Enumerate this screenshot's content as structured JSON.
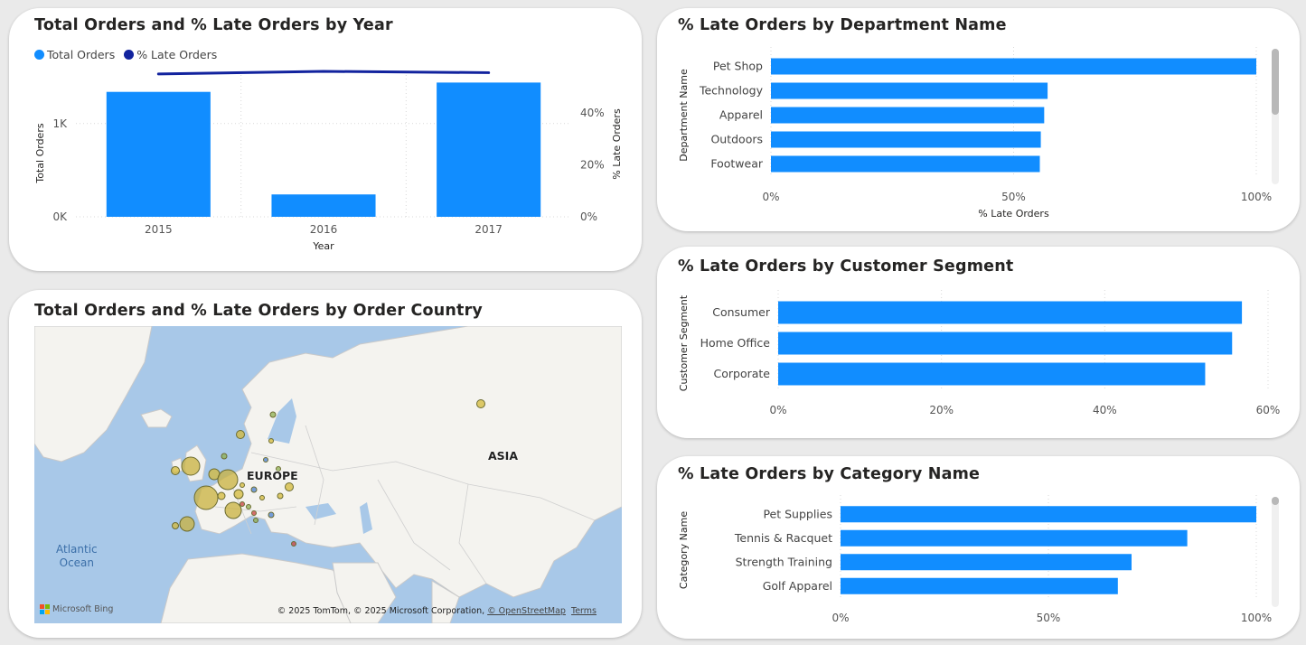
{
  "colors": {
    "bar": "#118dff",
    "line": "#12239e",
    "grid": "#d9d9d9",
    "water": "#a8c8e8",
    "land": "#f4f3ef"
  },
  "card1": {
    "title": "Total Orders and % Late Orders by Year",
    "legend": [
      {
        "label": "Total Orders",
        "color": "#118dff"
      },
      {
        "label": "% Late Orders",
        "color": "#12239e"
      }
    ]
  },
  "card2": {
    "title": "Total Orders and % Late Orders by Order Country",
    "labels": {
      "europe": "EUROPE",
      "asia": "ASIA",
      "ocean_line1": "Atlantic",
      "ocean_line2": "Ocean"
    },
    "bing": "Microsoft Bing",
    "copyright": "© 2025 TomTom, © 2025 Microsoft Corporation,",
    "osm": "© OpenStreetMap",
    "terms": "Terms"
  },
  "card3": {
    "title": "% Late Orders by Department Name"
  },
  "card4": {
    "title": "% Late Orders by Customer Segment"
  },
  "card5": {
    "title": "% Late Orders by Category Name"
  },
  "chart_data": [
    {
      "type": "bar+line",
      "title": "Total Orders and % Late Orders by Year",
      "categories": [
        "2015",
        "2016",
        "2017"
      ],
      "series": [
        {
          "name": "Total Orders",
          "type": "bar",
          "axis": "left",
          "values": [
            1340,
            240,
            1440
          ]
        },
        {
          "name": "% Late Orders",
          "type": "line",
          "axis": "right",
          "values": [
            0.55,
            0.56,
            0.555
          ]
        }
      ],
      "xlabel": "Year",
      "ylabel": "Total Orders",
      "y2label": "% Late Orders",
      "yticks": [
        "0K",
        "1K"
      ],
      "ylim": [
        0,
        1560
      ],
      "y2ticks": [
        "0%",
        "20%",
        "40%"
      ],
      "y2lim": [
        0,
        0.56
      ]
    },
    {
      "type": "bar",
      "orientation": "horizontal",
      "title": "% Late Orders by Department Name",
      "categories": [
        "Pet Shop",
        "Technology",
        "Apparel",
        "Outdoors",
        "Footwear"
      ],
      "values": [
        1.0,
        0.57,
        0.563,
        0.556,
        0.554
      ],
      "xlabel": "% Late Orders",
      "ylabel": "Department Name",
      "xticks": [
        "0%",
        "50%",
        "100%"
      ],
      "xlim": [
        0,
        1.0
      ]
    },
    {
      "type": "bar",
      "orientation": "horizontal",
      "title": "% Late Orders by Customer Segment",
      "categories": [
        "Consumer",
        "Home Office",
        "Corporate"
      ],
      "values": [
        0.568,
        0.556,
        0.523
      ],
      "xlabel": "",
      "ylabel": "Customer Segment",
      "xticks": [
        "0%",
        "20%",
        "40%",
        "60%"
      ],
      "xlim": [
        0,
        0.6
      ]
    },
    {
      "type": "bar",
      "orientation": "horizontal",
      "title": "% Late Orders by Category Name",
      "categories": [
        "Pet Supplies",
        "Tennis & Racquet",
        "Strength Training",
        "Golf Apparel"
      ],
      "values": [
        1.0,
        0.834,
        0.7,
        0.667
      ],
      "xlabel": "",
      "ylabel": "Category Name",
      "xticks": [
        "0%",
        "50%",
        "100%"
      ],
      "xlim": [
        0,
        1.0
      ]
    }
  ]
}
